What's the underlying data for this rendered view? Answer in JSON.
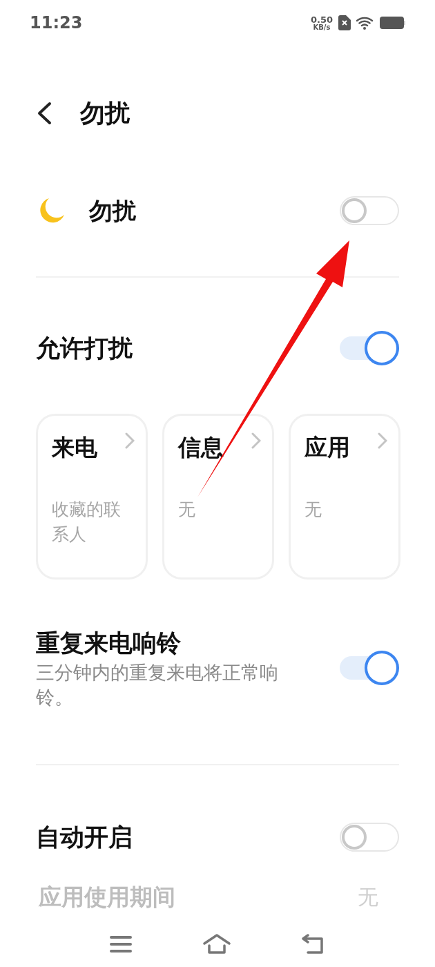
{
  "status_bar": {
    "time": "11:23",
    "speed_value": "0.50",
    "speed_unit": "KB/s"
  },
  "header": {
    "title": "勿扰"
  },
  "dnd": {
    "label": "勿扰",
    "on": false
  },
  "allow": {
    "title": "允许打扰",
    "on": true,
    "cards": [
      {
        "title": "来电",
        "value": "收藏的联系人"
      },
      {
        "title": "信息",
        "value": "无"
      },
      {
        "title": "应用",
        "value": "无"
      }
    ]
  },
  "repeat_calls": {
    "title": "重复来电响铃",
    "subtitle": "三分钟内的重复来电将正常响铃。",
    "on": true
  },
  "auto_on": {
    "title": "自动开启",
    "on": false
  },
  "partial_row": {
    "label": "应用使用期间",
    "value": "无"
  }
}
